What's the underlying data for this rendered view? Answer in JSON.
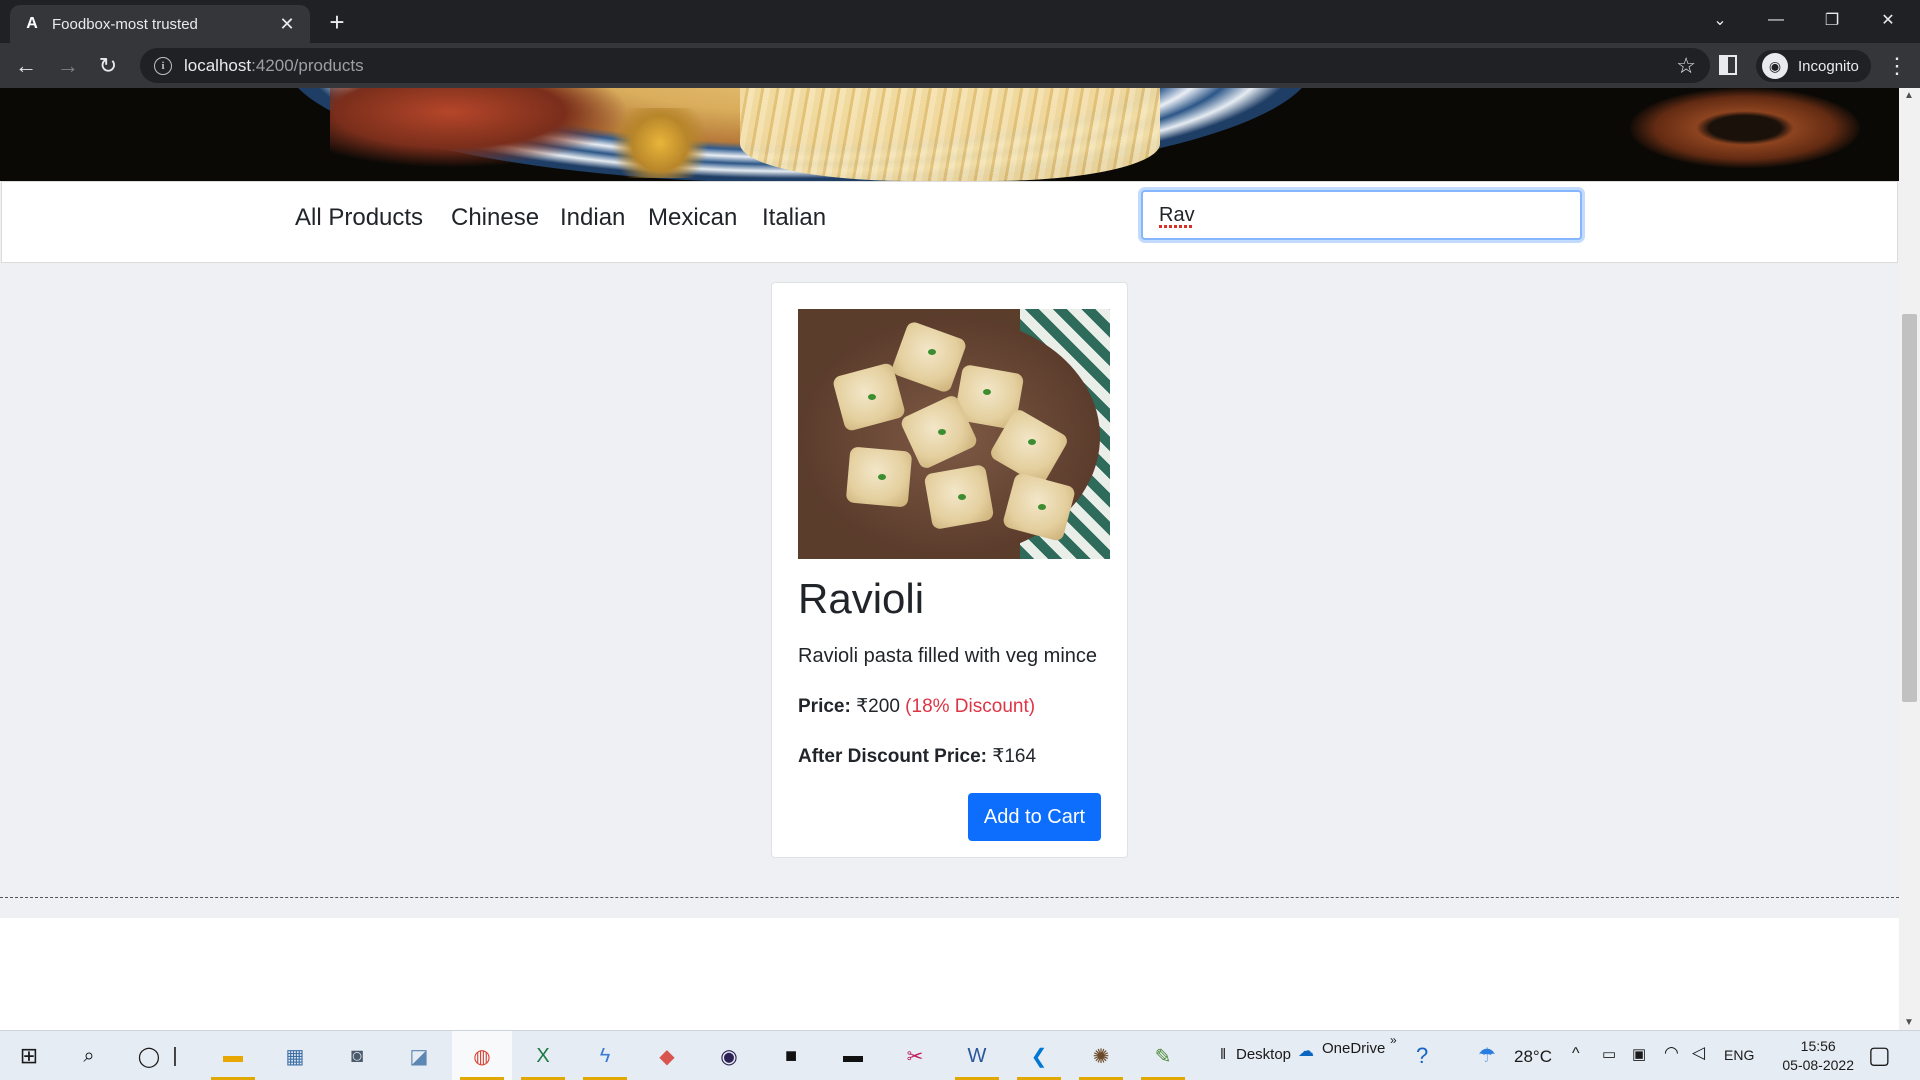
{
  "browser": {
    "tab_title": "Foodbox-most trusted",
    "tab_favicon": "A",
    "url_host": "localhost",
    "url_path": ":4200/products",
    "profile_label": "Incognito"
  },
  "navbar": {
    "links": [
      "All Products",
      "Chinese",
      "Indian",
      "Mexican",
      "Italian"
    ]
  },
  "search": {
    "value": "Rav"
  },
  "product": {
    "name": "Ravioli",
    "description": "Ravioli pasta filled with veg mince",
    "price_label": "Price:",
    "price": "₹200",
    "discount": "(18% Discount)",
    "after_label": "After Discount Price:",
    "after_price": "₹164",
    "button_label": "Add to Cart"
  },
  "taskbar": {
    "desktop_label": "Desktop",
    "onedrive_label": "OneDrive",
    "weather": "28°C",
    "language": "ENG",
    "time": "15:56",
    "date": "05-08-2022"
  },
  "colors": {
    "primary_button": "#0d6efd",
    "discount": "#dc3545"
  }
}
